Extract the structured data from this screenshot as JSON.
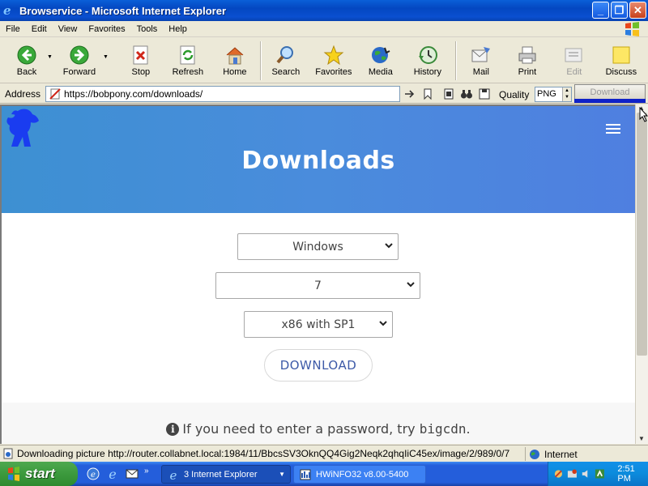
{
  "window": {
    "title": "Browservice - Microsoft Internet Explorer"
  },
  "menu": [
    "File",
    "Edit",
    "View",
    "Favorites",
    "Tools",
    "Help"
  ],
  "toolbar": {
    "back": "Back",
    "forward": "Forward",
    "stop": "Stop",
    "refresh": "Refresh",
    "home": "Home",
    "search": "Search",
    "favorites": "Favorites",
    "media": "Media",
    "history": "History",
    "mail": "Mail",
    "print": "Print",
    "edit": "Edit",
    "discuss": "Discuss"
  },
  "address": {
    "label": "Address",
    "url": "https://bobpony.com/downloads/",
    "quality_label": "Quality",
    "quality_value": "PNG",
    "download_label": "Download"
  },
  "page": {
    "heading": "Downloads",
    "os_select": "Windows",
    "version_select": "7",
    "arch_select": "x86 with SP1",
    "download_button": "DOWNLOAD",
    "notice_text": "If you need to enter a password, try",
    "notice_code": "bigcdn",
    "notice_end": "."
  },
  "status": {
    "text": "Downloading picture http://router.collabnet.local:1984/11/BbcsSV3OknQQ4Gig2Neqk2qhqIiC45ex/image/2/989/0/7",
    "zone": "Internet"
  },
  "taskbar": {
    "start": "start",
    "task_ie": "3 Internet Explorer",
    "task_hw": "HWiNFO32 v8.00-5400",
    "clock": "2:51 PM"
  },
  "colors": {
    "hero_start": "#3d90d2",
    "hero_end": "#4f7fe0",
    "download_text": "#3d5aa8"
  }
}
